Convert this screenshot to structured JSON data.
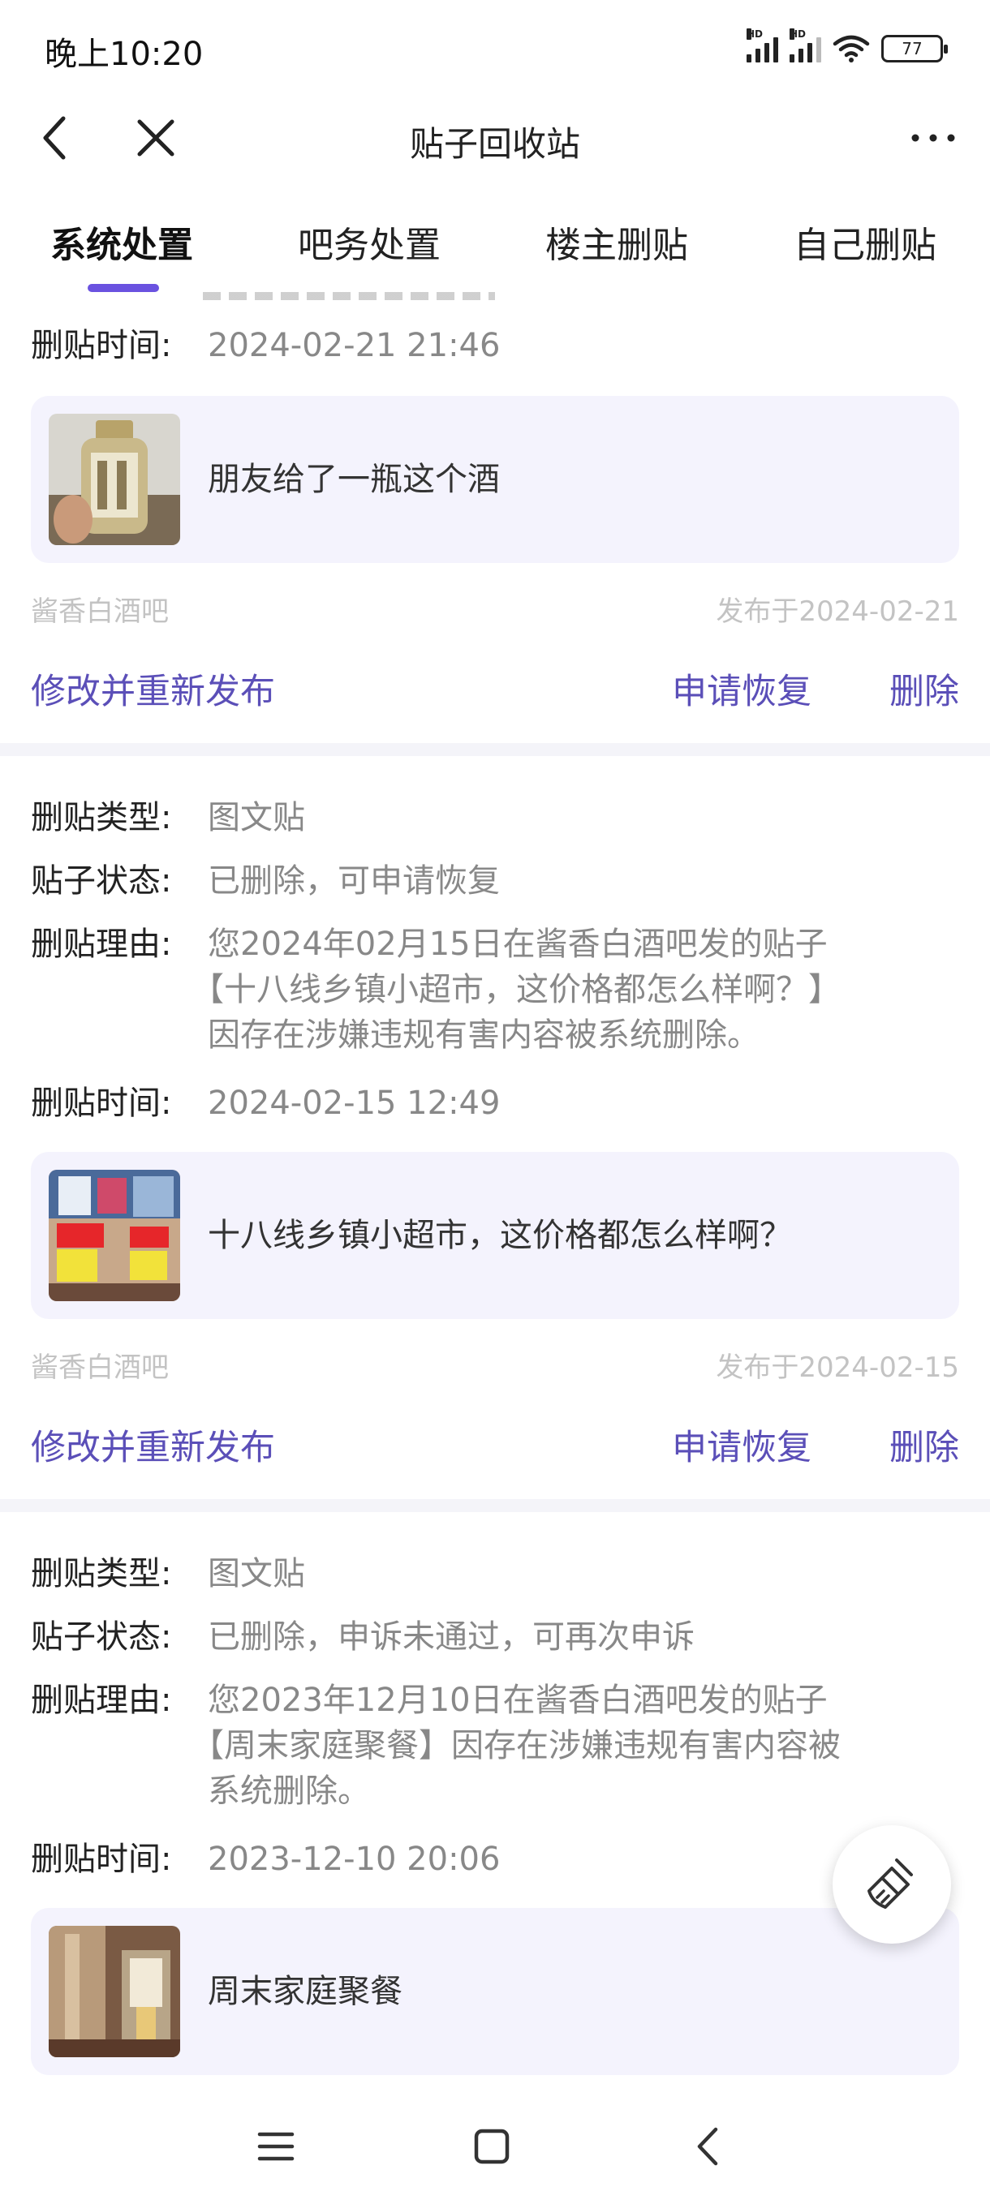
{
  "status_bar": {
    "time": "晚上10:20",
    "battery": "77",
    "signal_label": "HD"
  },
  "nav": {
    "title": "贴子回收站",
    "back_icon": "chevron-left-icon",
    "close_icon": "close-icon",
    "more_icon": "more-horizontal-icon"
  },
  "tabs": [
    {
      "label": "系统处置",
      "active": true
    },
    {
      "label": "吧务处置",
      "active": false
    },
    {
      "label": "楼主删贴",
      "active": false
    },
    {
      "label": "自己删贴",
      "active": false
    }
  ],
  "labels": {
    "type": "删贴类型:",
    "status": "贴子状态:",
    "reason": "删贴理由:",
    "time": "删贴时间:"
  },
  "posts": [
    {
      "time": "2024-02-21 21:46",
      "title": "朋友给了一瓶这个酒",
      "forum": "酱香白酒吧",
      "published": "发布于2024-02-21",
      "actions": {
        "edit": "修改并重新发布",
        "recover": "申请恢复",
        "delete": "删除"
      }
    },
    {
      "type": "图文贴",
      "status": "已删除，可申请恢复",
      "reason_line1": "您2024年02月15日在酱香白酒吧发的贴子",
      "reason_line2": "【十八线乡镇小超市，这价格都怎么样啊？】",
      "reason_line3": "因存在涉嫌违规有害内容被系统删除。",
      "time": "2024-02-15 12:49",
      "title": "十八线乡镇小超市，这价格都怎么样啊？",
      "forum": "酱香白酒吧",
      "published": "发布于2024-02-15",
      "actions": {
        "edit": "修改并重新发布",
        "recover": "申请恢复",
        "delete": "删除"
      }
    },
    {
      "type": "图文贴",
      "status": "已删除，申诉未通过，可再次申诉",
      "reason_line1": "您2023年12月10日在酱香白酒吧发的贴子",
      "reason_line2": "【周末家庭聚餐】因存在涉嫌违规有害内容被",
      "reason_line3": "系统删除。",
      "time": "2023-12-10 20:06",
      "title": "周末家庭聚餐"
    }
  ],
  "fab_icon": "broom-icon",
  "bottom_nav": {
    "menu_icon": "menu-icon",
    "home_icon": "home-square-icon",
    "back_icon": "back-triangle-icon"
  },
  "colors": {
    "accent": "#6a52e0",
    "action_text": "#5b4fb8",
    "card_bg": "#f4f3fd",
    "muted": "#888888",
    "meta": "#c3c3c3"
  }
}
